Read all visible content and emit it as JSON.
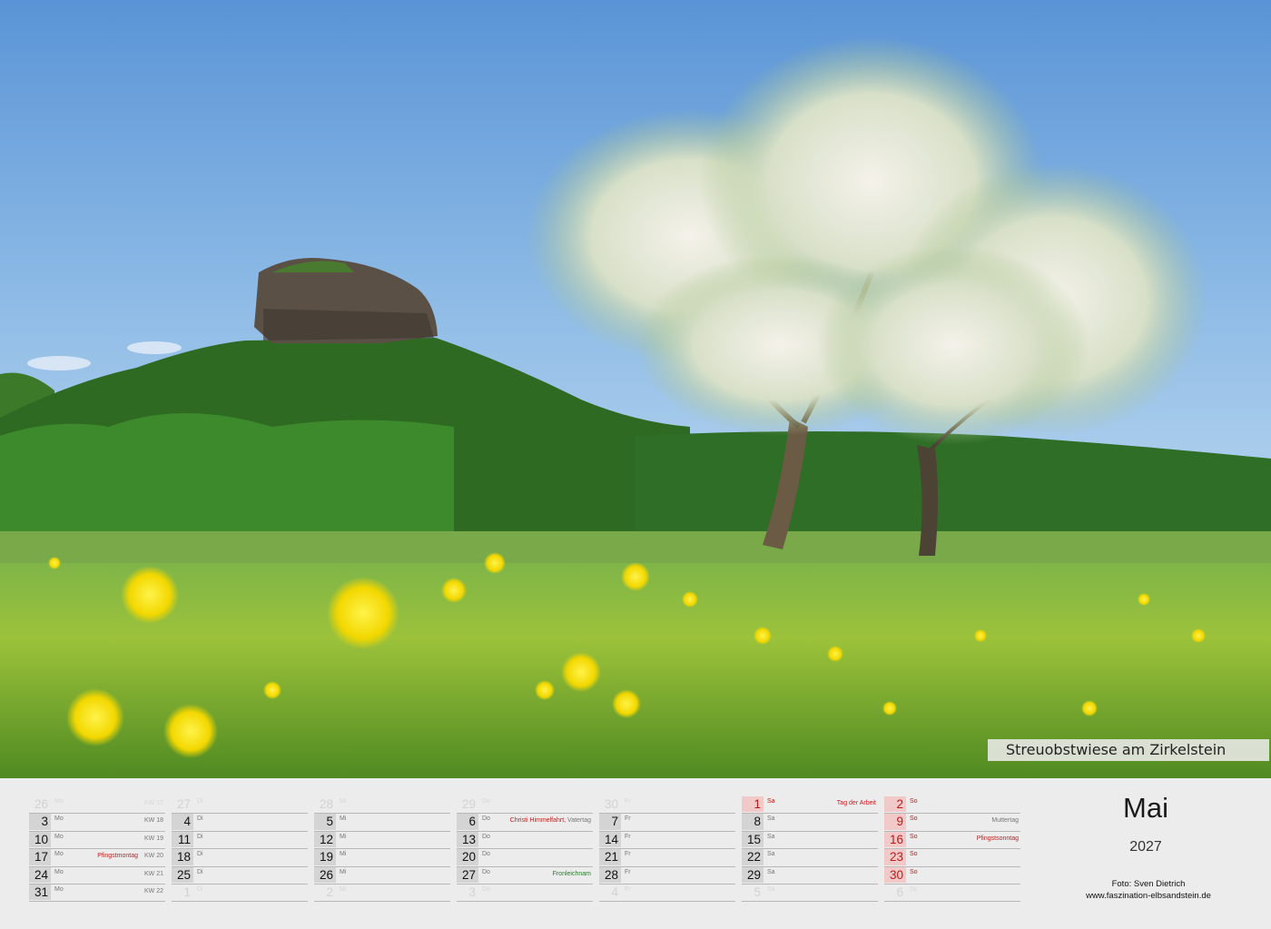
{
  "caption": "Streuobstwiese am Zirkelstein",
  "month": "Mai",
  "year": "2027",
  "credit": {
    "photographer": "Foto: Sven Dietrich",
    "website": "www.faszination-elbsandstein.de"
  },
  "columns": [
    {
      "rows": [
        {
          "num": "26",
          "wd": "Mo",
          "kw": "KW 17",
          "faint": true
        },
        {
          "num": "3",
          "wd": "Mo",
          "kw": "KW 18"
        },
        {
          "num": "10",
          "wd": "Mo",
          "kw": "KW 19"
        },
        {
          "num": "17",
          "wd": "Mo",
          "hol": "Pfingstmontag",
          "kw": "KW 20"
        },
        {
          "num": "24",
          "wd": "Mo",
          "kw": "KW 21"
        },
        {
          "num": "31",
          "wd": "Mo",
          "kw": "KW 22"
        }
      ]
    },
    {
      "rows": [
        {
          "num": "27",
          "wd": "Di",
          "faint": true
        },
        {
          "num": "4",
          "wd": "Di"
        },
        {
          "num": "11",
          "wd": "Di"
        },
        {
          "num": "18",
          "wd": "Di"
        },
        {
          "num": "25",
          "wd": "Di"
        },
        {
          "num": "1",
          "wd": "Di",
          "faint": true
        }
      ]
    },
    {
      "rows": [
        {
          "num": "28",
          "wd": "Mi",
          "faint": true
        },
        {
          "num": "5",
          "wd": "Mi"
        },
        {
          "num": "12",
          "wd": "Mi"
        },
        {
          "num": "19",
          "wd": "Mi"
        },
        {
          "num": "26",
          "wd": "Mi"
        },
        {
          "num": "2",
          "wd": "Mi",
          "faint": true
        }
      ]
    },
    {
      "rows": [
        {
          "num": "29",
          "wd": "Do",
          "faint": true
        },
        {
          "num": "6",
          "wd": "Do",
          "hol": "Christi Himmelfahrt,",
          "hol2": " Vatertag"
        },
        {
          "num": "13",
          "wd": "Do"
        },
        {
          "num": "20",
          "wd": "Do"
        },
        {
          "num": "27",
          "wd": "Do",
          "holg": "Fronleichnam"
        },
        {
          "num": "3",
          "wd": "Do",
          "faint": true
        }
      ]
    },
    {
      "rows": [
        {
          "num": "30",
          "wd": "Fr",
          "faint": true
        },
        {
          "num": "7",
          "wd": "Fr"
        },
        {
          "num": "14",
          "wd": "Fr"
        },
        {
          "num": "21",
          "wd": "Fr"
        },
        {
          "num": "28",
          "wd": "Fr"
        },
        {
          "num": "4",
          "wd": "Fr",
          "faint": true
        }
      ]
    },
    {
      "rows": [
        {
          "num": "1",
          "wd": "Sa",
          "hol": "Tag der Arbeit",
          "red": true
        },
        {
          "num": "8",
          "wd": "Sa"
        },
        {
          "num": "15",
          "wd": "Sa"
        },
        {
          "num": "22",
          "wd": "Sa"
        },
        {
          "num": "29",
          "wd": "Sa"
        },
        {
          "num": "5",
          "wd": "Sa",
          "faint": true
        }
      ]
    },
    {
      "rows": [
        {
          "num": "2",
          "wd": "So",
          "red": true
        },
        {
          "num": "9",
          "wd": "So",
          "holgray": "Muttertag",
          "red": true
        },
        {
          "num": "16",
          "wd": "So",
          "hol": "Pfingstsonntag",
          "red": true
        },
        {
          "num": "23",
          "wd": "So",
          "red": true
        },
        {
          "num": "30",
          "wd": "So",
          "red": true
        },
        {
          "num": "6",
          "wd": "So",
          "faint": true
        }
      ]
    }
  ]
}
